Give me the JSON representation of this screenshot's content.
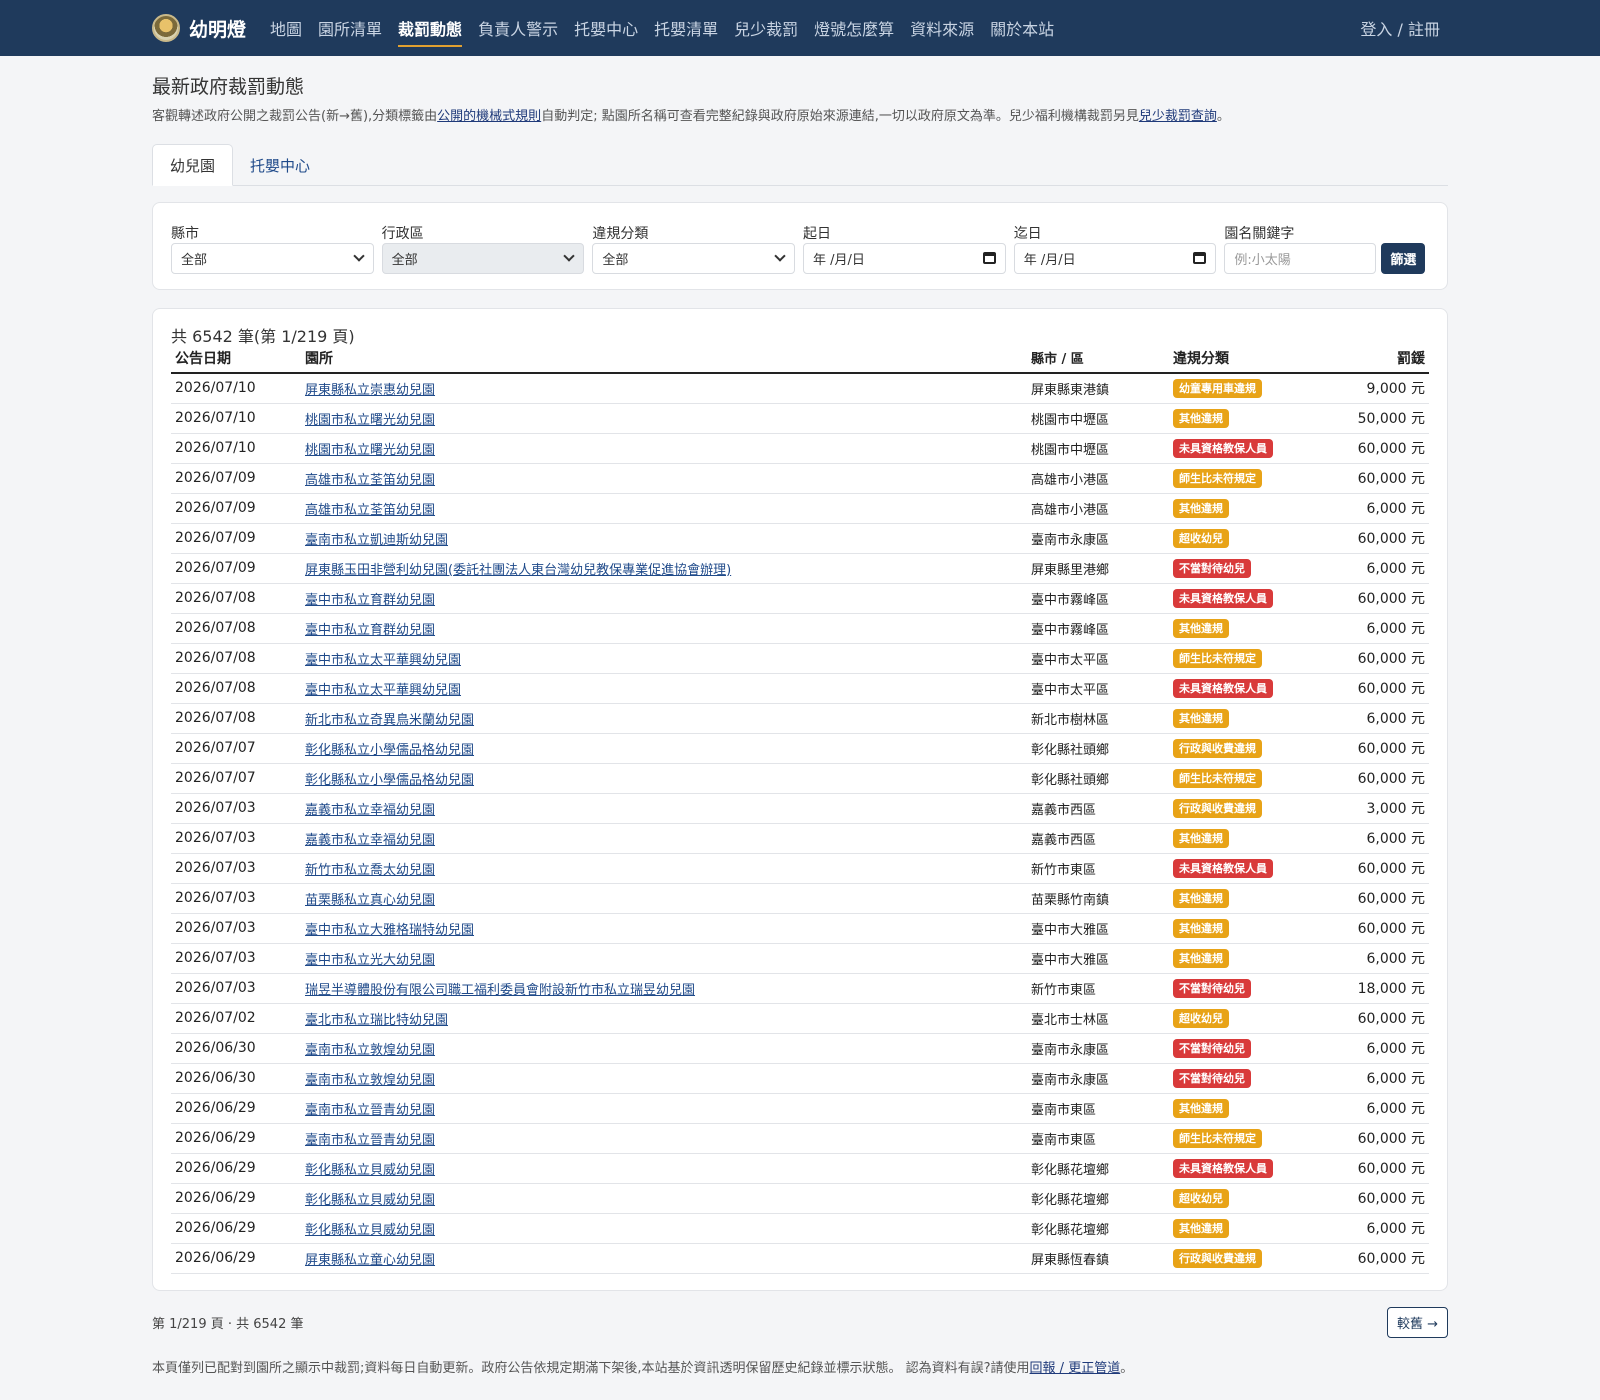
{
  "nav": {
    "brand": "幼明燈",
    "links": [
      "地圖",
      "園所清單",
      "裁罰動態",
      "負責人警示",
      "托嬰中心",
      "托嬰清單",
      "兒少裁罰",
      "燈號怎麼算",
      "資料來源",
      "關於本站"
    ],
    "login": "登入 / 註冊"
  },
  "page": {
    "title": "最新政府裁罰動態",
    "desc_a": "客觀轉述政府公開之裁罰公告(新→舊),分類標籤由",
    "desc_link1": "公開的機械式規則",
    "desc_b": "自動判定; 點園所名稱可查看完整紀錄與政府原始來源連結,一切以政府原文為準。兒少福利機構裁罰另見",
    "desc_link2": "兒少裁罰查詢",
    "desc_c": "。"
  },
  "tabs": [
    "幼兒園",
    "托嬰中心"
  ],
  "filters": {
    "county_label": "縣市",
    "county_value": "全部",
    "district_label": "行政區",
    "district_value": "全部",
    "category_label": "違規分類",
    "category_value": "全部",
    "start_label": "起日",
    "start_value": "年 /月/日",
    "end_label": "迄日",
    "end_value": "年 /月/日",
    "keyword_label": "園名關鍵字",
    "keyword_placeholder": "例:小太陽",
    "submit": "篩選"
  },
  "table": {
    "count": "共 6542 筆(第 1/219 頁)",
    "headers": [
      "公告日期",
      "園所",
      "縣市 / 區",
      "違規分類",
      "罰鍰"
    ],
    "rows": [
      [
        "2026/07/10",
        "屏東縣私立崇惠幼兒園",
        "屏東縣東港鎮",
        "幼童專用車違規",
        "9,000 元",
        "#e8a317"
      ],
      [
        "2026/07/10",
        "桃園市私立曙光幼兒園",
        "桃園市中壢區",
        "其他違規",
        "50,000 元",
        "#e8a317"
      ],
      [
        "2026/07/10",
        "桃園市私立曙光幼兒園",
        "桃園市中壢區",
        "未具資格教保人員",
        "60,000 元",
        "#d93a3a"
      ],
      [
        "2026/07/09",
        "高雄市私立荃笛幼兒園",
        "高雄市小港區",
        "師生比未符規定",
        "60,000 元",
        "#e8a317"
      ],
      [
        "2026/07/09",
        "高雄市私立荃笛幼兒園",
        "高雄市小港區",
        "其他違規",
        "6,000 元",
        "#e8a317"
      ],
      [
        "2026/07/09",
        "臺南市私立凱迪斯幼兒園",
        "臺南市永康區",
        "超收幼兒",
        "60,000 元",
        "#e8a317"
      ],
      [
        "2026/07/09",
        "屏東縣玉田非營利幼兒園(委託社團法人東台灣幼兒教保專業促進協會辦理)",
        "屏東縣里港鄉",
        "不當對待幼兒",
        "6,000 元",
        "#d93a3a"
      ],
      [
        "2026/07/08",
        "臺中市私立育群幼兒園",
        "臺中市霧峰區",
        "未具資格教保人員",
        "60,000 元",
        "#d93a3a"
      ],
      [
        "2026/07/08",
        "臺中市私立育群幼兒園",
        "臺中市霧峰區",
        "其他違規",
        "6,000 元",
        "#e8a317"
      ],
      [
        "2026/07/08",
        "臺中市私立太平華興幼兒園",
        "臺中市太平區",
        "師生比未符規定",
        "60,000 元",
        "#e8a317"
      ],
      [
        "2026/07/08",
        "臺中市私立太平華興幼兒園",
        "臺中市太平區",
        "未具資格教保人員",
        "60,000 元",
        "#d93a3a"
      ],
      [
        "2026/07/08",
        "新北市私立奇異鳥米蘭幼兒園",
        "新北市樹林區",
        "其他違規",
        "6,000 元",
        "#e8a317"
      ],
      [
        "2026/07/07",
        "彰化縣私立小學儒品格幼兒園",
        "彰化縣社頭鄉",
        "行政與收費違規",
        "60,000 元",
        "#e8a317"
      ],
      [
        "2026/07/07",
        "彰化縣私立小學儒品格幼兒園",
        "彰化縣社頭鄉",
        "師生比未符規定",
        "60,000 元",
        "#e8a317"
      ],
      [
        "2026/07/03",
        "嘉義市私立幸福幼兒園",
        "嘉義市西區",
        "行政與收費違規",
        "3,000 元",
        "#e8a317"
      ],
      [
        "2026/07/03",
        "嘉義市私立幸福幼兒園",
        "嘉義市西區",
        "其他違規",
        "6,000 元",
        "#e8a317"
      ],
      [
        "2026/07/03",
        "新竹市私立喬太幼兒園",
        "新竹市東區",
        "未具資格教保人員",
        "60,000 元",
        "#d93a3a"
      ],
      [
        "2026/07/03",
        "苗栗縣私立真心幼兒園",
        "苗栗縣竹南鎮",
        "其他違規",
        "60,000 元",
        "#e8a317"
      ],
      [
        "2026/07/03",
        "臺中市私立大雅格瑞特幼兒園",
        "臺中市大雅區",
        "其他違規",
        "60,000 元",
        "#e8a317"
      ],
      [
        "2026/07/03",
        "臺中市私立光大幼兒園",
        "臺中市大雅區",
        "其他違規",
        "6,000 元",
        "#e8a317"
      ],
      [
        "2026/07/03",
        "瑞昱半導體股份有限公司職工福利委員會附設新竹市私立瑞昱幼兒園",
        "新竹市東區",
        "不當對待幼兒",
        "18,000 元",
        "#d93a3a"
      ],
      [
        "2026/07/02",
        "臺北市私立瑞比特幼兒園",
        "臺北市士林區",
        "超收幼兒",
        "60,000 元",
        "#e8a317"
      ],
      [
        "2026/06/30",
        "臺南市私立敦煌幼兒園",
        "臺南市永康區",
        "不當對待幼兒",
        "6,000 元",
        "#d93a3a"
      ],
      [
        "2026/06/30",
        "臺南市私立敦煌幼兒園",
        "臺南市永康區",
        "不當對待幼兒",
        "6,000 元",
        "#d93a3a"
      ],
      [
        "2026/06/29",
        "臺南市私立晉青幼兒園",
        "臺南市東區",
        "其他違規",
        "6,000 元",
        "#e8a317"
      ],
      [
        "2026/06/29",
        "臺南市私立晉青幼兒園",
        "臺南市東區",
        "師生比未符規定",
        "60,000 元",
        "#e8a317"
      ],
      [
        "2026/06/29",
        "彰化縣私立貝威幼兒園",
        "彰化縣花壇鄉",
        "未具資格教保人員",
        "60,000 元",
        "#d93a3a"
      ],
      [
        "2026/06/29",
        "彰化縣私立貝威幼兒園",
        "彰化縣花壇鄉",
        "超收幼兒",
        "60,000 元",
        "#e8a317"
      ],
      [
        "2026/06/29",
        "彰化縣私立貝威幼兒園",
        "彰化縣花壇鄉",
        "其他違規",
        "6,000 元",
        "#e8a317"
      ],
      [
        "2026/06/29",
        "屏東縣私立童心幼兒園",
        "屏東縣恆春鎮",
        "行政與收費違規",
        "60,000 元",
        "#e8a317"
      ]
    ]
  },
  "pager": {
    "info": "第 1/219 頁 · 共 6542 筆",
    "next": "較舊 →"
  },
  "footer": {
    "note_a": "本頁僅列已配對到園所之顯示中裁罰;資料每日自動更新。政府公告依規定期滿下架後,本站基於資訊透明保留歷史紀錄並標示狀態。 認為資料有誤?請使用",
    "note_link": "回報 / 更正管道",
    "note_b": "。"
  }
}
